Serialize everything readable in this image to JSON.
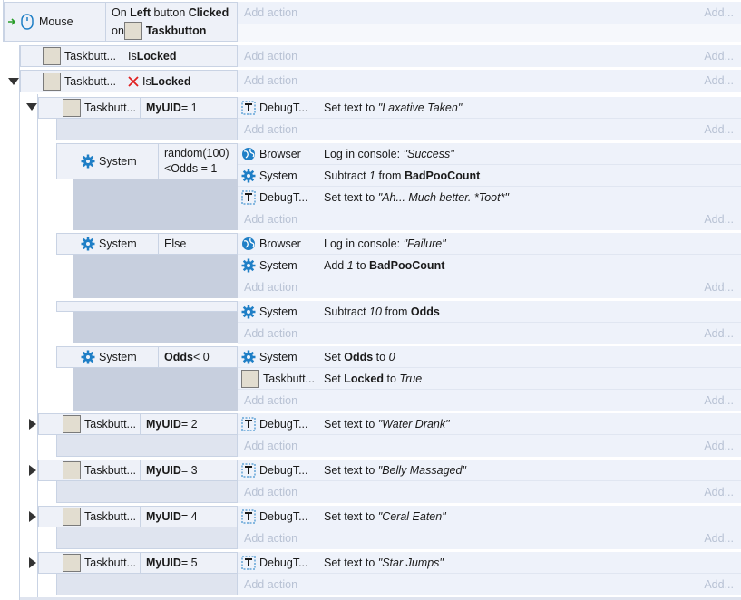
{
  "event1": {
    "trigger": {
      "object": "Mouse",
      "l1a": "On ",
      "l1b": "Left",
      "l1c": " button ",
      "l1d": "Clicked",
      "l2a": "on ",
      "l2b": "Taskbutton"
    },
    "add_action": "Add action",
    "add": "Add..."
  },
  "event2": {
    "object": "Taskbutt...",
    "pre": "Is ",
    "bold": "Locked",
    "add_action": "Add action",
    "add": "Add..."
  },
  "event3": {
    "object": "Taskbutt...",
    "pre": "Is ",
    "bold": "Locked",
    "add_action": "Add action",
    "add": "Add..."
  },
  "sub1": {
    "object": "Taskbutt...",
    "var": "MyUID",
    "op": " = 1",
    "action": {
      "object": "DebugT...",
      "pre": "Set text to ",
      "val": "\"Laxative Taken\""
    },
    "add_action": "Add action",
    "add": "Add..."
  },
  "random_block": {
    "object": "System",
    "line1": "random(100)",
    "line2": "<Odds = 1",
    "actions": [
      {
        "object": "Browser",
        "pre": "Log in console: ",
        "val": "\"Success\""
      },
      {
        "object": "System",
        "pre": "Subtract ",
        "num": "1",
        "mid": " from ",
        "bold": "BadPooCount"
      },
      {
        "object": "DebugT...",
        "pre": "Set text to ",
        "val": "\"Ah... Much better. *Toot*\""
      }
    ],
    "add_action": "Add action",
    "add": "Add..."
  },
  "else_block": {
    "object": "System",
    "cond": "Else",
    "actions": [
      {
        "object": "Browser",
        "pre": "Log in console: ",
        "val": "\"Failure\""
      },
      {
        "object": "System",
        "pre": "Add ",
        "num": "1",
        "mid": " to ",
        "bold": "BadPooCount"
      }
    ],
    "add_action": "Add action",
    "add": "Add..."
  },
  "blank_block": {
    "actions": [
      {
        "object": "System",
        "pre": "Subtract ",
        "num": "10",
        "mid": " from ",
        "bold": "Odds"
      }
    ],
    "add_action": "Add action",
    "add": "Add..."
  },
  "odds_block": {
    "object": "System",
    "var": "Odds",
    "op": " < 0",
    "actions": [
      {
        "object": "System",
        "pre": "Set ",
        "bold": "Odds",
        "mid": " to ",
        "val": "0"
      },
      {
        "object": "Taskbutt...",
        "pre": "Set ",
        "bold": "Locked",
        "mid": " to ",
        "val": "True"
      }
    ],
    "add_action": "Add action",
    "add": "Add..."
  },
  "collapsed": [
    {
      "object": "Taskbutt...",
      "var": "MyUID",
      "op": " = 2",
      "aobj": "DebugT...",
      "pre": "Set text to ",
      "val": "\"Water Drank\"",
      "add_action": "Add action",
      "add": "Add..."
    },
    {
      "object": "Taskbutt...",
      "var": "MyUID",
      "op": " = 3",
      "aobj": "DebugT...",
      "pre": "Set text to ",
      "val": "\"Belly Massaged\"",
      "add_action": "Add action",
      "add": "Add..."
    },
    {
      "object": "Taskbutt...",
      "var": "MyUID",
      "op": " = 4",
      "aobj": "DebugT...",
      "pre": "Set text to ",
      "val": "\"Ceral Eaten\"",
      "add_action": "Add action",
      "add": "Add..."
    },
    {
      "object": "Taskbutt...",
      "var": "MyUID",
      "op": " = 5",
      "aobj": "DebugT...",
      "pre": "Set text to ",
      "val": "\"Star Jumps\"",
      "add_action": "Add action",
      "add": "Add..."
    }
  ],
  "colors": {
    "accent_gear": "#1f7fc6",
    "cross": "#e02020",
    "trigger_arrow": "#2a9d2a"
  }
}
